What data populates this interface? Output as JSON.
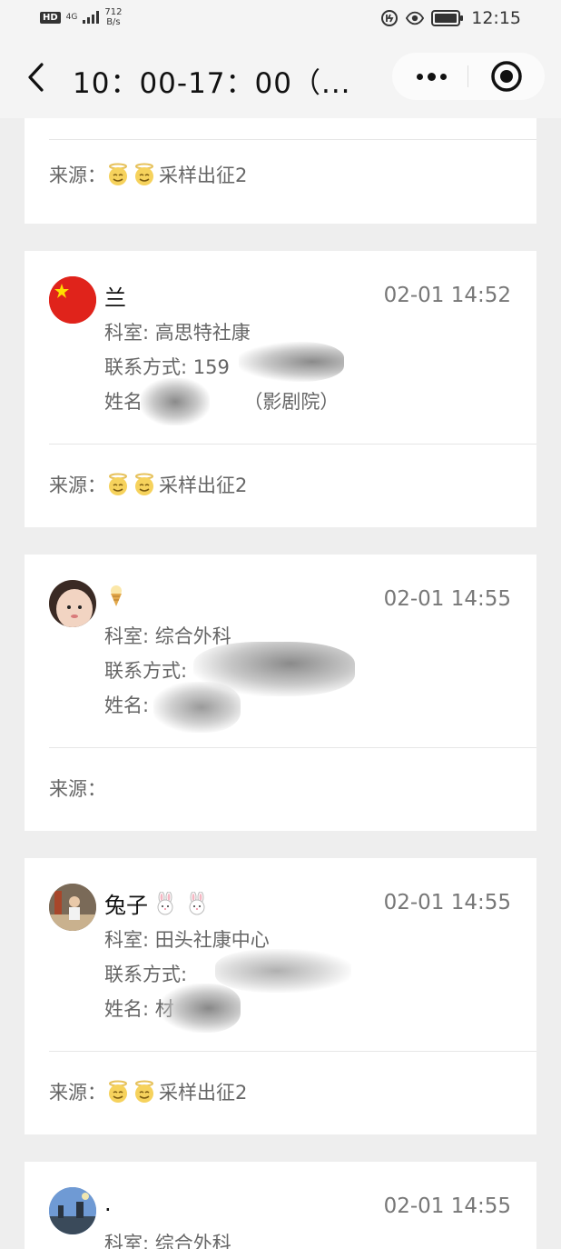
{
  "status_bar": {
    "hd": "HD",
    "network": "4G",
    "speed_value": "712",
    "speed_unit": "B/s",
    "time": "12:15"
  },
  "nav": {
    "title": "10：00-17：00（..."
  },
  "top_card": {
    "source_label": "来源：",
    "source_value": "采样出征2"
  },
  "entries": [
    {
      "name": "兰",
      "date": "02-01 14:52",
      "dept_label": "科室: 高思特社康",
      "contact_label": "联系方式: 159",
      "name_label": "姓名",
      "name_suffix": "（影剧院）",
      "source_label": "来源：",
      "source_value": "采样出征2",
      "avatar_icon": "flag-avatar"
    },
    {
      "name": "",
      "date": "02-01 14:55",
      "dept_label": "科室: 综合外科",
      "contact_label": "联系方式:",
      "name_label": "姓名: ",
      "name_suffix": "",
      "source_label": "来源：",
      "source_value": "",
      "avatar_icon": "baby-photo-avatar"
    },
    {
      "name": "兔子",
      "date": "02-01 14:55",
      "dept_label": "科室: 田头社康中心",
      "contact_label": "联系方式:",
      "name_label": "姓名: 材",
      "name_suffix": "",
      "source_label": "来源：",
      "source_value": "采样出征2",
      "avatar_icon": "photo-avatar"
    },
    {
      "name": ".",
      "date": "02-01 14:55",
      "dept_label": "科室: 综合外科",
      "avatar_icon": "landscape-avatar"
    }
  ]
}
